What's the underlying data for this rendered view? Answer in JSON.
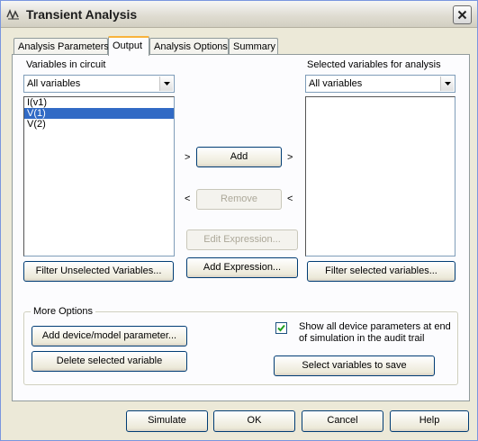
{
  "window": {
    "title": "Transient Analysis"
  },
  "tabs": [
    {
      "label": "Analysis Parameters"
    },
    {
      "label": "Output"
    },
    {
      "label": "Analysis Options"
    },
    {
      "label": "Summary"
    }
  ],
  "left": {
    "heading": "Variables in circuit",
    "dropdown_value": "All variables",
    "items": [
      "I(v1)",
      "V(1)",
      "V(2)"
    ],
    "filter_button": "Filter Unselected Variables..."
  },
  "right": {
    "heading": "Selected variables for analysis",
    "dropdown_value": "All variables",
    "filter_button": "Filter selected variables..."
  },
  "middle": {
    "add_label": "Add",
    "remove_label": "Remove",
    "edit_expression_label": "Edit Expression...",
    "add_expression_label": "Add Expression...",
    "chevron_right": ">",
    "chevron_left": "<"
  },
  "more_options": {
    "title": "More Options",
    "add_param_button": "Add device/model parameter...",
    "delete_var_button": "Delete selected variable",
    "show_params_label_line1": "Show all device parameters at end",
    "show_params_label_line2": "of simulation in the audit trail",
    "show_params_checked": true,
    "select_save_button": "Select variables to save"
  },
  "footer": {
    "simulate": "Simulate",
    "ok": "OK",
    "cancel": "Cancel",
    "help": "Help"
  }
}
